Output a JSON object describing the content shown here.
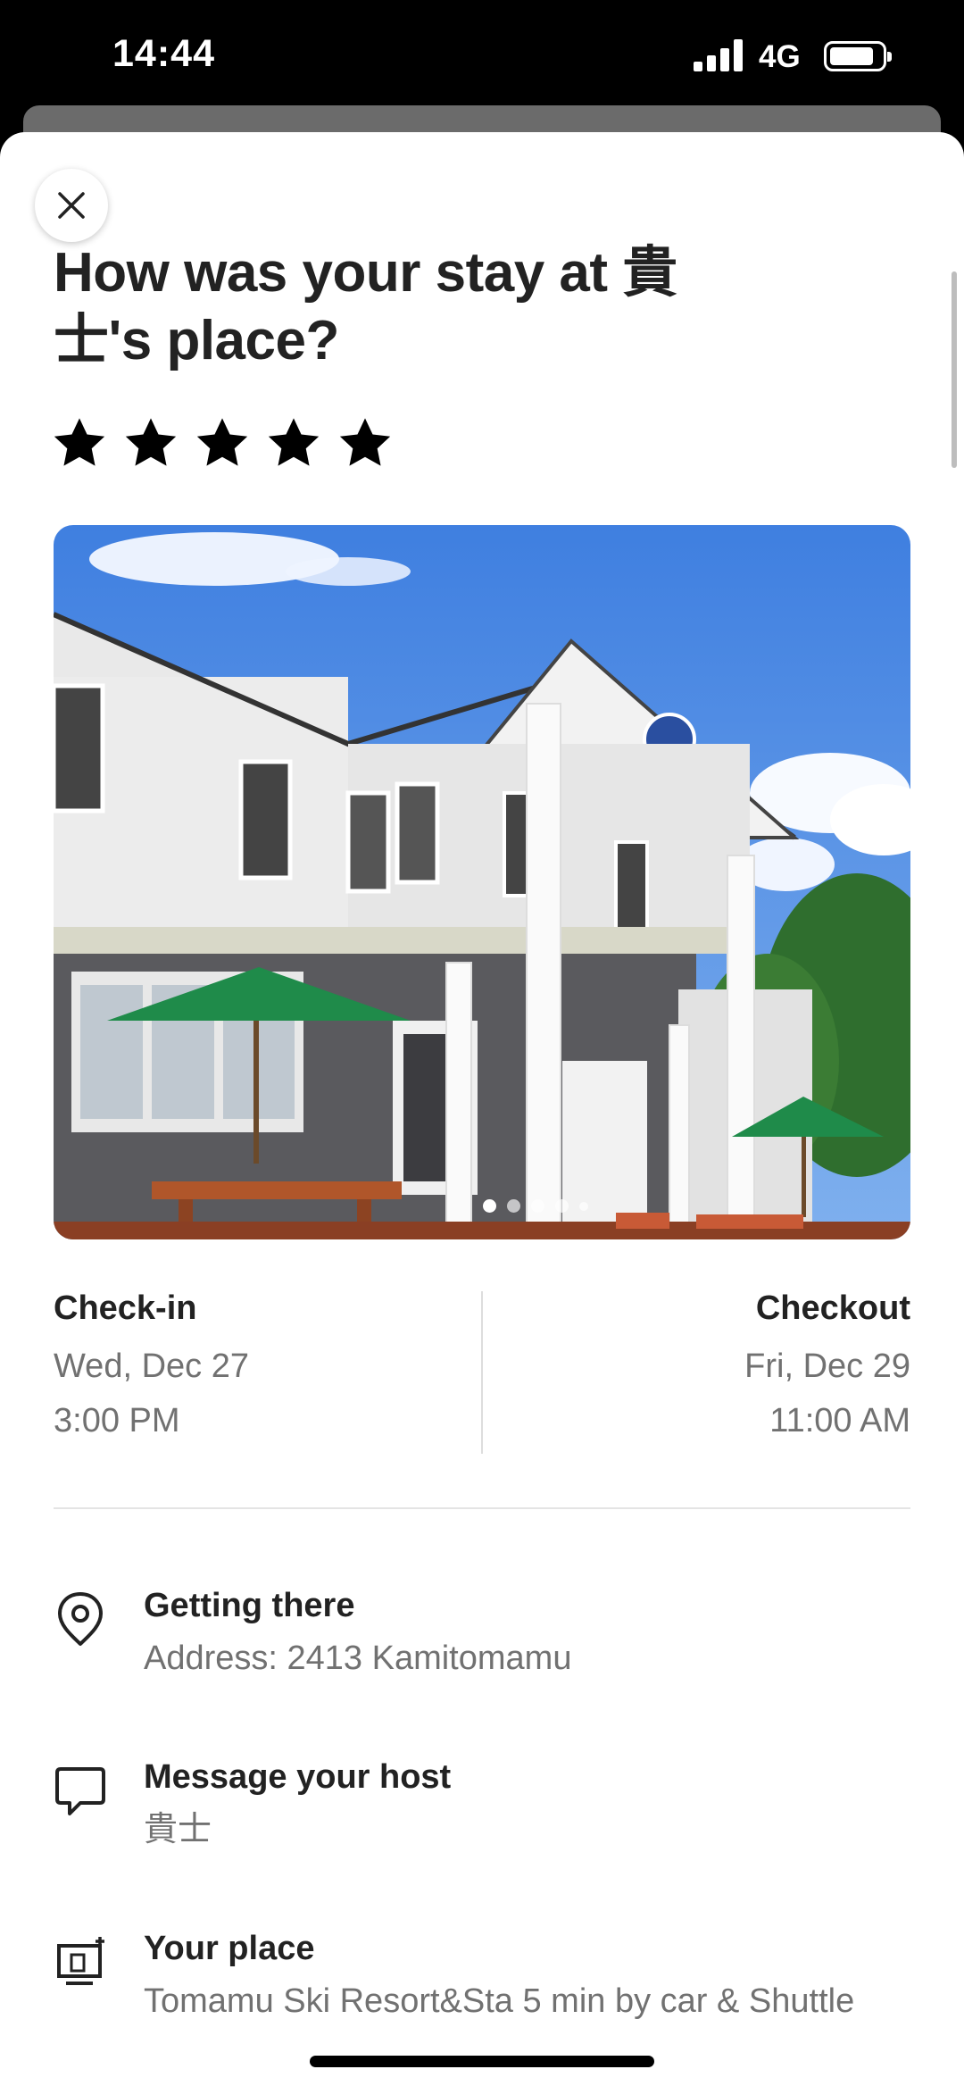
{
  "status_bar": {
    "time": "14:44",
    "network": "4G"
  },
  "review": {
    "title": "How was your stay at 貴士's place?",
    "rating": 5,
    "rating_max": 5,
    "photo": {
      "description_icon": "house-photo",
      "page_count": 5,
      "active_page": 1
    }
  },
  "stay": {
    "checkin_label": "Check-in",
    "checkin_date": "Wed, Dec 27",
    "checkin_time": "3:00 PM",
    "checkout_label": "Checkout",
    "checkout_date": "Fri, Dec 29",
    "checkout_time": "11:00 AM"
  },
  "details": [
    {
      "icon": "location-pin-icon",
      "title": "Getting there",
      "subtitle": "Address: 2413 Kamitomamu"
    },
    {
      "icon": "message-icon",
      "title": "Message your host",
      "subtitle": "貴士"
    },
    {
      "icon": "house-icon",
      "title": "Your place",
      "subtitle": "Tomamu Ski Resort&Sta 5 min by car & Shuttle"
    }
  ],
  "colors": {
    "text_primary": "#222222",
    "text_secondary": "#717171",
    "divider": "#dddddd",
    "sky": "#5b93e6",
    "umbrella": "#1f8b4a"
  }
}
